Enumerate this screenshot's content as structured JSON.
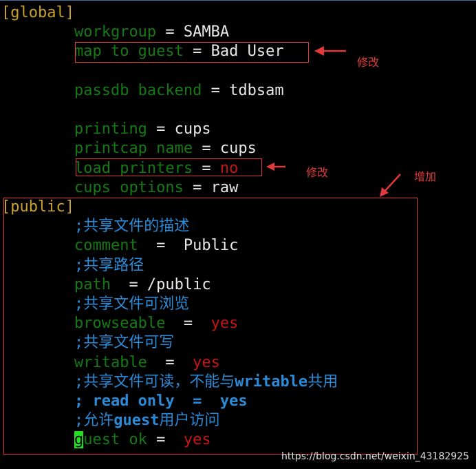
{
  "editor": {
    "lines": [
      {
        "tokens": [
          {
            "t": "[global]",
            "c": "c-section"
          }
        ]
      },
      {
        "tokens": [
          {
            "t": "        ",
            "c": "c-text"
          },
          {
            "t": "workgroup",
            "c": "c-key"
          },
          {
            "t": " = SAMBA",
            "c": "c-text"
          }
        ]
      },
      {
        "tokens": [
          {
            "t": "        ",
            "c": "c-text"
          },
          {
            "t": "map to guest",
            "c": "c-key"
          },
          {
            "t": " = Bad User",
            "c": "c-text"
          }
        ]
      },
      {
        "tokens": []
      },
      {
        "tokens": [
          {
            "t": "        ",
            "c": "c-text"
          },
          {
            "t": "passdb backend",
            "c": "c-key"
          },
          {
            "t": " = tdbsam",
            "c": "c-text"
          }
        ]
      },
      {
        "tokens": []
      },
      {
        "tokens": [
          {
            "t": "        ",
            "c": "c-text"
          },
          {
            "t": "printing",
            "c": "c-key"
          },
          {
            "t": " = cups",
            "c": "c-text"
          }
        ]
      },
      {
        "tokens": [
          {
            "t": "        ",
            "c": "c-text"
          },
          {
            "t": "printcap name",
            "c": "c-key"
          },
          {
            "t": " = cups",
            "c": "c-text"
          }
        ]
      },
      {
        "tokens": [
          {
            "t": "        ",
            "c": "c-text"
          },
          {
            "t": "load printers",
            "c": "c-key"
          },
          {
            "t": " = ",
            "c": "c-text"
          },
          {
            "t": "no",
            "c": "c-red"
          }
        ]
      },
      {
        "tokens": [
          {
            "t": "        ",
            "c": "c-text"
          },
          {
            "t": "cups options",
            "c": "c-key"
          },
          {
            "t": " = raw",
            "c": "c-text"
          }
        ]
      },
      {
        "tokens": [
          {
            "t": "[public]",
            "c": "c-section"
          }
        ]
      },
      {
        "tokens": [
          {
            "t": "        ",
            "c": "c-text"
          },
          {
            "t": ";共享文件的描述",
            "c": "c-comment"
          }
        ]
      },
      {
        "tokens": [
          {
            "t": "        ",
            "c": "c-text"
          },
          {
            "t": "comment",
            "c": "c-key"
          },
          {
            "t": "  =  Public",
            "c": "c-text"
          }
        ]
      },
      {
        "tokens": [
          {
            "t": "        ",
            "c": "c-text"
          },
          {
            "t": ";共享路径",
            "c": "c-comment"
          }
        ]
      },
      {
        "tokens": [
          {
            "t": "        ",
            "c": "c-text"
          },
          {
            "t": "path",
            "c": "c-key"
          },
          {
            "t": "  = /public",
            "c": "c-text"
          }
        ]
      },
      {
        "tokens": [
          {
            "t": "        ",
            "c": "c-text"
          },
          {
            "t": ";共享文件可浏览",
            "c": "c-comment"
          }
        ]
      },
      {
        "tokens": [
          {
            "t": "        ",
            "c": "c-text"
          },
          {
            "t": "browseable",
            "c": "c-key"
          },
          {
            "t": "  =  ",
            "c": "c-text"
          },
          {
            "t": "yes",
            "c": "c-red"
          }
        ]
      },
      {
        "tokens": [
          {
            "t": "        ",
            "c": "c-text"
          },
          {
            "t": ";共享文件可写",
            "c": "c-comment"
          }
        ]
      },
      {
        "tokens": [
          {
            "t": "        ",
            "c": "c-text"
          },
          {
            "t": "writable",
            "c": "c-key"
          },
          {
            "t": "  =  ",
            "c": "c-text"
          },
          {
            "t": "yes",
            "c": "c-red"
          }
        ]
      },
      {
        "tokens": [
          {
            "t": "        ",
            "c": "c-text"
          },
          {
            "t": ";共享文件可读，不能与",
            "c": "c-comment"
          },
          {
            "t": "writable",
            "c": "c-bold-comment"
          },
          {
            "t": "共用",
            "c": "c-comment"
          }
        ]
      },
      {
        "tokens": [
          {
            "t": "        ",
            "c": "c-text"
          },
          {
            "t": "; read only  =  yes",
            "c": "c-bold-comment"
          }
        ]
      },
      {
        "tokens": [
          {
            "t": "        ",
            "c": "c-text"
          },
          {
            "t": ";允许",
            "c": "c-comment"
          },
          {
            "t": "guest",
            "c": "c-bold-comment"
          },
          {
            "t": "用户访问",
            "c": "c-comment"
          }
        ]
      },
      {
        "tokens": [
          {
            "t": "        ",
            "c": "c-text"
          },
          {
            "t": "g",
            "c": "cursor"
          },
          {
            "t": "uest ok",
            "c": "c-key"
          },
          {
            "t": " =  ",
            "c": "c-text"
          },
          {
            "t": "yes",
            "c": "c-red"
          }
        ]
      }
    ]
  },
  "annotations": {
    "modify_1": "修改",
    "modify_2": "修改",
    "add": "增加",
    "accent_color": "#e23a3a"
  },
  "watermark": "https://blog.csdn.net/weixin_43182925"
}
